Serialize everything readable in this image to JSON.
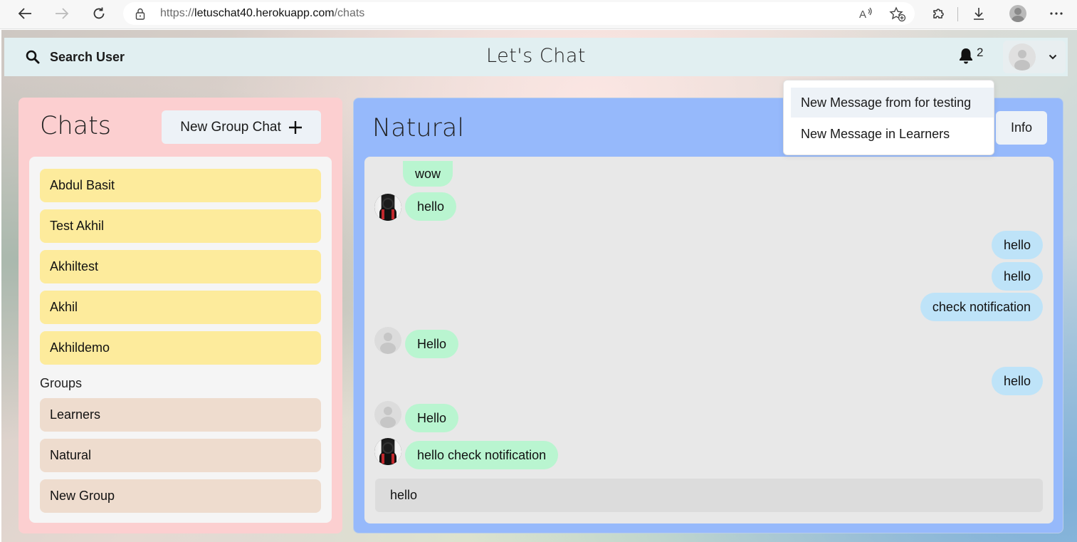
{
  "browser": {
    "url_scheme": "https://",
    "url_host": "letuschat40.herokuapp.com",
    "url_path": "/chats"
  },
  "header": {
    "search_label": "Search User",
    "app_title": "Let's Chat",
    "notification_count": "2"
  },
  "notifications": [
    "New Message from for testing",
    "New Message in Learners"
  ],
  "chats_panel": {
    "title": "Chats",
    "new_group_label": "New Group Chat",
    "users": [
      "Abdul Basit",
      "Test Akhil",
      "Akhiltest",
      "Akhil",
      "Akhildemo"
    ],
    "groups_label": "Groups",
    "groups": [
      "Learners",
      "Natural",
      "New Group"
    ]
  },
  "conversation": {
    "title": "Natural",
    "info_label": "Info",
    "messages": [
      {
        "text": "wow",
        "dir": "in",
        "avatar": "none"
      },
      {
        "text": "hello",
        "dir": "in",
        "avatar": "photo"
      },
      {
        "text": "hello",
        "dir": "out"
      },
      {
        "text": "hello",
        "dir": "out"
      },
      {
        "text": "check notification",
        "dir": "out"
      },
      {
        "text": "Hello",
        "dir": "in",
        "avatar": "gray"
      },
      {
        "text": "hello",
        "dir": "out"
      },
      {
        "text": "Hello",
        "dir": "in",
        "avatar": "gray"
      },
      {
        "text": "hello check notification",
        "dir": "in",
        "avatar": "photo"
      }
    ],
    "input_value": "hello"
  },
  "colors": {
    "header_bg": "#e1eff1",
    "chats_panel_bg": "#fccfd0",
    "convo_panel_bg": "#96b9fb",
    "user_item_bg": "#fdeb9c",
    "group_item_bg": "#eedcce",
    "incoming_bubble": "#b9f5d0",
    "outgoing_bubble": "#bee3f8"
  }
}
